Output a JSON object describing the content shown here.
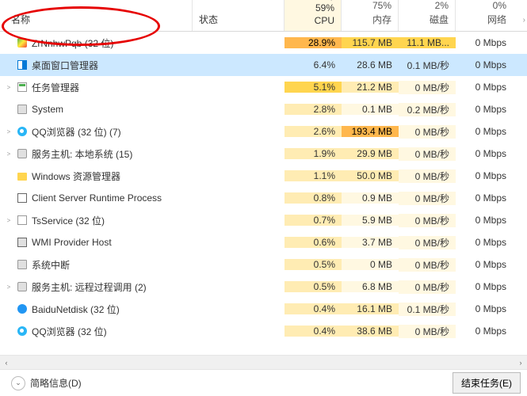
{
  "columns": {
    "name": "名称",
    "status": "状态",
    "cpu": {
      "percent": "59%",
      "label": "CPU"
    },
    "mem": {
      "percent": "75%",
      "label": "内存"
    },
    "disk": {
      "percent": "2%",
      "label": "磁盘"
    },
    "net": {
      "percent": "0%",
      "label": "网络"
    }
  },
  "rows": [
    {
      "expand": "",
      "icon": "ic-cube",
      "name": "ZrNnhwPqb (32 位)",
      "cpu": "28.9%",
      "cpu_h": "heat-4",
      "mem": "115.7 MB",
      "mem_h": "heat-3",
      "disk": "11.1 MB...",
      "disk_h": "heat-3",
      "net": "0 Mbps",
      "selected": false
    },
    {
      "expand": "",
      "icon": "ic-dwm",
      "name": "桌面窗口管理器",
      "cpu": "6.4%",
      "cpu_h": "heat-sel",
      "mem": "28.6 MB",
      "mem_h": "heat-sel",
      "disk": "0.1 MB/秒",
      "disk_h": "heat-sel",
      "net": "0 Mbps",
      "selected": true
    },
    {
      "expand": ">",
      "icon": "ic-task",
      "name": "任务管理器",
      "cpu": "5.1%",
      "cpu_h": "heat-3",
      "mem": "21.2 MB",
      "mem_h": "heat-2",
      "disk": "0 MB/秒",
      "disk_h": "heat-1",
      "net": "0 Mbps",
      "selected": false
    },
    {
      "expand": "",
      "icon": "ic-sys",
      "name": "System",
      "cpu": "2.8%",
      "cpu_h": "heat-2",
      "mem": "0.1 MB",
      "mem_h": "heat-1",
      "disk": "0.2 MB/秒",
      "disk_h": "heat-1",
      "net": "0 Mbps",
      "selected": false
    },
    {
      "expand": ">",
      "icon": "ic-qq",
      "name": "QQ浏览器 (32 位) (7)",
      "cpu": "2.6%",
      "cpu_h": "heat-2",
      "mem": "193.4 MB",
      "mem_h": "heat-4",
      "disk": "0 MB/秒",
      "disk_h": "heat-1",
      "net": "0 Mbps",
      "selected": false
    },
    {
      "expand": ">",
      "icon": "ic-gear",
      "name": "服务主机: 本地系统 (15)",
      "cpu": "1.9%",
      "cpu_h": "heat-2",
      "mem": "29.9 MB",
      "mem_h": "heat-2",
      "disk": "0 MB/秒",
      "disk_h": "heat-1",
      "net": "0 Mbps",
      "selected": false
    },
    {
      "expand": "",
      "icon": "ic-folder",
      "name": "Windows 资源管理器",
      "cpu": "1.1%",
      "cpu_h": "heat-2",
      "mem": "50.0 MB",
      "mem_h": "heat-2",
      "disk": "0 MB/秒",
      "disk_h": "heat-1",
      "net": "0 Mbps",
      "selected": false
    },
    {
      "expand": "",
      "icon": "ic-window",
      "name": "Client Server Runtime Process",
      "cpu": "0.8%",
      "cpu_h": "heat-2",
      "mem": "0.9 MB",
      "mem_h": "heat-1",
      "disk": "0 MB/秒",
      "disk_h": "heat-1",
      "net": "0 Mbps",
      "selected": false
    },
    {
      "expand": ">",
      "icon": "ic-svc",
      "name": "TsService (32 位)",
      "cpu": "0.7%",
      "cpu_h": "heat-2",
      "mem": "5.9 MB",
      "mem_h": "heat-1",
      "disk": "0 MB/秒",
      "disk_h": "heat-1",
      "net": "0 Mbps",
      "selected": false
    },
    {
      "expand": "",
      "icon": "ic-wmi",
      "name": "WMI Provider Host",
      "cpu": "0.6%",
      "cpu_h": "heat-2",
      "mem": "3.7 MB",
      "mem_h": "heat-1",
      "disk": "0 MB/秒",
      "disk_h": "heat-1",
      "net": "0 Mbps",
      "selected": false
    },
    {
      "expand": "",
      "icon": "ic-sys",
      "name": "系统中断",
      "cpu": "0.5%",
      "cpu_h": "heat-2",
      "mem": "0 MB",
      "mem_h": "heat-1",
      "disk": "0 MB/秒",
      "disk_h": "heat-1",
      "net": "0 Mbps",
      "selected": false
    },
    {
      "expand": ">",
      "icon": "ic-gear",
      "name": "服务主机: 远程过程调用 (2)",
      "cpu": "0.5%",
      "cpu_h": "heat-2",
      "mem": "6.8 MB",
      "mem_h": "heat-1",
      "disk": "0 MB/秒",
      "disk_h": "heat-1",
      "net": "0 Mbps",
      "selected": false
    },
    {
      "expand": "",
      "icon": "ic-baidu",
      "name": "BaiduNetdisk (32 位)",
      "cpu": "0.4%",
      "cpu_h": "heat-2",
      "mem": "16.1 MB",
      "mem_h": "heat-2",
      "disk": "0.1 MB/秒",
      "disk_h": "heat-1",
      "net": "0 Mbps",
      "selected": false
    },
    {
      "expand": "",
      "icon": "ic-qq",
      "name": "QQ浏览器 (32 位)",
      "cpu": "0.4%",
      "cpu_h": "heat-2",
      "mem": "38.6 MB",
      "mem_h": "heat-2",
      "disk": "0 MB/秒",
      "disk_h": "heat-1",
      "net": "0 Mbps",
      "selected": false
    }
  ],
  "footer": {
    "brief": "简略信息(D)",
    "end_task": "结束任务(E)"
  }
}
